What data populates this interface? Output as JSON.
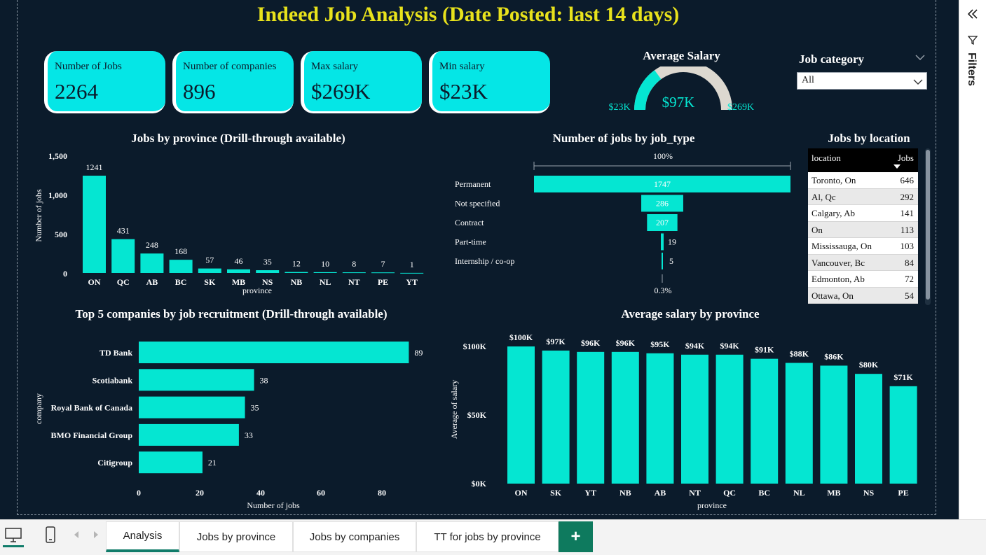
{
  "title": "Indeed Job Analysis (Date Posted: last 14 days)",
  "kpis": [
    {
      "label": "Number of Jobs",
      "value": "2264"
    },
    {
      "label": "Number of companies",
      "value": "896"
    },
    {
      "label": "Max salary",
      "value": "$269K"
    },
    {
      "label": "Min salary",
      "value": "$23K"
    }
  ],
  "gauge": {
    "title": "Average Salary",
    "value_label": "$97K",
    "min_label": "$23K",
    "max_label": "$269K",
    "value": 97,
    "min": 23,
    "max": 269
  },
  "slicer": {
    "title": "Job category",
    "selected": "All"
  },
  "province_chart": {
    "title": "Jobs by province (Drill-through available)",
    "ylabel": "Number of jobs",
    "xlabel": "province",
    "yticks": [
      "1,500",
      "1,000",
      "500",
      "0"
    ]
  },
  "jobtype_chart": {
    "title": "Number of jobs by job_type",
    "top_label": "100%",
    "bottom_label": "0.3%"
  },
  "location_table": {
    "title": "Jobs by location",
    "col1": "location",
    "col2": "Jobs",
    "rows": [
      {
        "location": "Toronto, On",
        "jobs": "646"
      },
      {
        "location": "Al, Qc",
        "jobs": "292"
      },
      {
        "location": "Calgary, Ab",
        "jobs": "141"
      },
      {
        "location": "On",
        "jobs": "113"
      },
      {
        "location": "Mississauga, On",
        "jobs": "103"
      },
      {
        "location": "Vancouver, Bc",
        "jobs": "84"
      },
      {
        "location": "Edmonton, Ab",
        "jobs": "72"
      },
      {
        "location": "Ottawa, On",
        "jobs": "54"
      }
    ]
  },
  "companies_chart": {
    "title": "Top 5 companies by job recruitment (Drill-through available)",
    "ylabel": "company",
    "xlabel": "Number of jobs",
    "xticks": [
      "0",
      "20",
      "40",
      "60",
      "80"
    ]
  },
  "salary_chart": {
    "title": "Average salary by province",
    "ylabel": "Average of salary",
    "xlabel": "province",
    "yticks": [
      "$100K",
      "$50K",
      "$0K"
    ]
  },
  "filters_label": "Filters",
  "tabs": [
    "Analysis",
    "Jobs by province",
    "Jobs by companies",
    "TT for jobs by province"
  ],
  "colors": {
    "bar": "#05e6d2",
    "background": "#0b1b2b",
    "title": "#e8e21c",
    "kpi": "#05e6e6",
    "tab_accent": "#0e7a5e"
  },
  "chart_data": [
    {
      "type": "bar",
      "title": "Jobs by province (Drill-through available)",
      "xlabel": "province",
      "ylabel": "Number of jobs",
      "categories": [
        "ON",
        "QC",
        "AB",
        "BC",
        "SK",
        "MB",
        "NS",
        "NB",
        "NL",
        "NT",
        "PE",
        "YT"
      ],
      "values": [
        1241,
        431,
        248,
        168,
        57,
        46,
        35,
        12,
        10,
        8,
        7,
        1
      ],
      "ylim": [
        0,
        1500
      ]
    },
    {
      "type": "bar",
      "orientation": "funnel",
      "title": "Number of jobs by job_type",
      "categories": [
        "Permanent",
        "Not specified",
        "Contract",
        "Part-time",
        "Internship / co-op"
      ],
      "values": [
        1747,
        286,
        207,
        19,
        5
      ]
    },
    {
      "type": "bar",
      "orientation": "horizontal",
      "title": "Top 5 companies by job recruitment (Drill-through available)",
      "xlabel": "Number of jobs",
      "ylabel": "company",
      "categories": [
        "TD Bank",
        "Scotiabank",
        "Royal Bank of Canada",
        "BMO Financial Group",
        "Citigroup"
      ],
      "values": [
        89,
        38,
        35,
        33,
        21
      ],
      "xlim": [
        0,
        90
      ]
    },
    {
      "type": "bar",
      "title": "Average salary by province",
      "xlabel": "province",
      "ylabel": "Average of salary",
      "categories": [
        "ON",
        "SK",
        "YT",
        "NB",
        "AB",
        "NT",
        "QC",
        "BC",
        "NL",
        "MB",
        "NS",
        "PE"
      ],
      "values": [
        100,
        97,
        96,
        96,
        95,
        94,
        94,
        91,
        88,
        86,
        80,
        71
      ],
      "labels": [
        "$100K",
        "$97K",
        "$96K",
        "$96K",
        "$95K",
        "$94K",
        "$94K",
        "$91K",
        "$88K",
        "$86K",
        "$80K",
        "$71K"
      ],
      "unit": "$K",
      "ylim": [
        0,
        100
      ]
    },
    {
      "type": "table",
      "title": "Jobs by location",
      "columns": [
        "location",
        "Jobs"
      ],
      "rows": [
        [
          "Toronto, On",
          646
        ],
        [
          "Al, Qc",
          292
        ],
        [
          "Calgary, Ab",
          141
        ],
        [
          "On",
          113
        ],
        [
          "Mississauga, On",
          103
        ],
        [
          "Vancouver, Bc",
          84
        ],
        [
          "Edmonton, Ab",
          72
        ],
        [
          "Ottawa, On",
          54
        ]
      ]
    }
  ]
}
